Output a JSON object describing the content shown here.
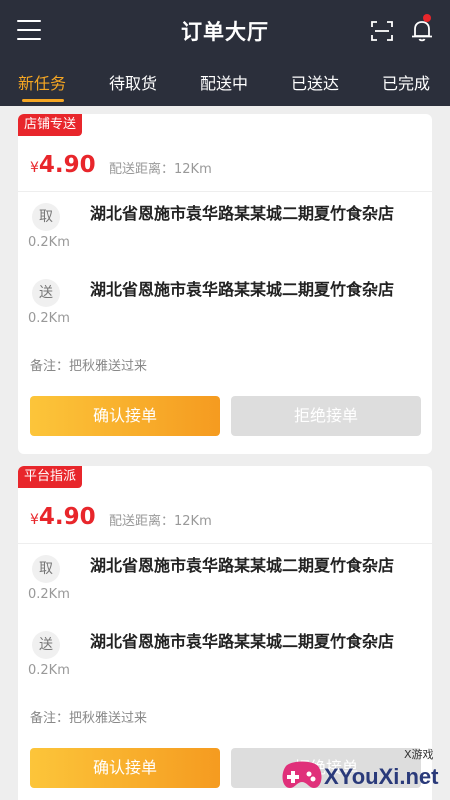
{
  "header": {
    "title": "订单大厅",
    "menu_icon": "menu-icon",
    "scan_icon": "scan-icon",
    "bell_icon": "bell-icon",
    "has_notification": true
  },
  "tabs": [
    {
      "label": "新任务",
      "active": true
    },
    {
      "label": "待取货",
      "active": false
    },
    {
      "label": "配送中",
      "active": false
    },
    {
      "label": "已送达",
      "active": false
    },
    {
      "label": "已完成",
      "active": false
    }
  ],
  "orders": [
    {
      "badge": "店铺专送",
      "currency": "¥",
      "price": "4.90",
      "distance": "配送距离：12Km",
      "pickup": {
        "tag": "取",
        "km": "0.2Km",
        "address": "湖北省恩施市袁华路某某城二期夏竹食杂店"
      },
      "dropoff": {
        "tag": "送",
        "km": "0.2Km",
        "address": "湖北省恩施市袁华路某某城二期夏竹食杂店"
      },
      "note": "备注：把秋雅送过来",
      "accept_label": "确认接单",
      "reject_label": "拒绝接单"
    },
    {
      "badge": "平台指派",
      "currency": "¥",
      "price": "4.90",
      "distance": "配送距离：12Km",
      "pickup": {
        "tag": "取",
        "km": "0.2Km",
        "address": "湖北省恩施市袁华路某某城二期夏竹食杂店"
      },
      "dropoff": {
        "tag": "送",
        "km": "0.2Km",
        "address": "湖北省恩施市袁华路某某城二期夏竹食杂店"
      },
      "note": "备注：把秋雅送过来",
      "accept_label": "确认接单",
      "reject_label": "拒绝接单"
    }
  ],
  "watermark": {
    "text": "XYouXi.net",
    "small": "X游戏"
  },
  "colors": {
    "header_bg": "#2b2f3b",
    "accent": "#f5a623",
    "price_red": "#e8262b",
    "badge_red": "#e8262b"
  }
}
